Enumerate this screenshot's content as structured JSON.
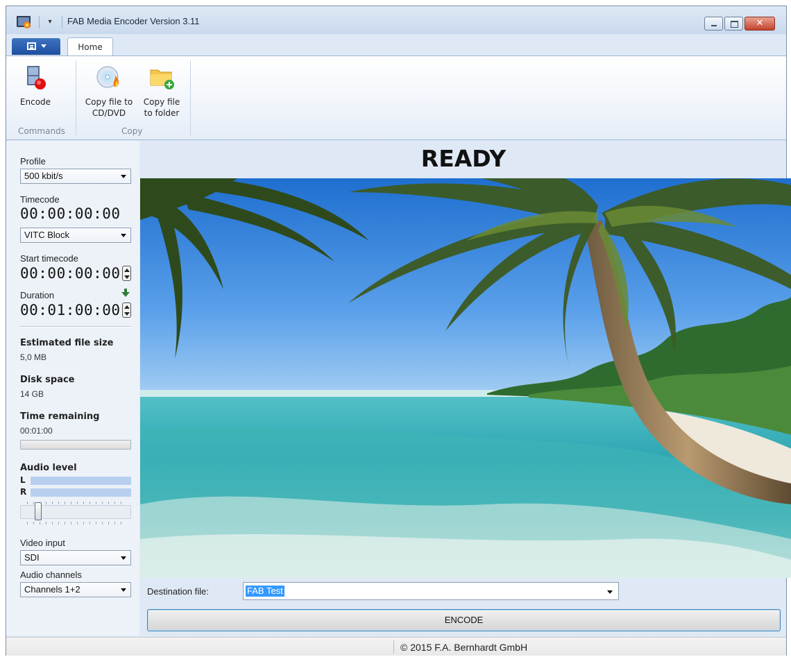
{
  "window": {
    "title": "FAB Media Encoder  Version 3.11",
    "icons": [
      "app-icon",
      "quick-access-dropdown-icon",
      "minimize-icon",
      "maximize-icon",
      "close-icon"
    ]
  },
  "ribbon": {
    "tabs": [
      {
        "label": "Home",
        "active": true
      }
    ],
    "buttons": {
      "encode": {
        "label": "Encode",
        "icon": "film-record-icon"
      },
      "copy_cd": {
        "label1": "Copy file to",
        "label2": "CD/DVD",
        "icon": "disc-burn-icon"
      },
      "copy_folder": {
        "label1": "Copy file",
        "label2": "to folder",
        "icon": "folder-add-icon"
      }
    },
    "groups": {
      "commands": "Commands",
      "copy": "Copy"
    }
  },
  "left": {
    "profile_label": "Profile",
    "profile_value": "500 kbit/s",
    "timecode_label": "Timecode",
    "timecode_value": "00:00:00:00",
    "timecode_source": "VITC Block",
    "start_timecode_label": "Start timecode",
    "start_timecode_value": "00:00:00:00",
    "duration_label": "Duration",
    "duration_value": "00:01:00:00",
    "est_size_label": "Estimated file size",
    "est_size_value": "5,0 MB",
    "disk_label": "Disk space",
    "disk_value": "14 GB",
    "time_remaining_label": "Time remaining",
    "time_remaining_value": "00:01:00",
    "time_remaining_progress": 0,
    "audio_label": "Audio level",
    "audio_l": "L",
    "audio_r": "R",
    "audio_slider_level": 0.1,
    "video_input_label": "Video input",
    "video_input_value": "SDI",
    "audio_channels_label": "Audio channels",
    "audio_channels_value": "Channels 1+2"
  },
  "main": {
    "status": "READY",
    "destination_label": "Destination file:",
    "destination_value": "FAB Test",
    "encode_button": "ENCODE"
  },
  "statusbar": {
    "copyright": "© 2015 F.A. Bernhardt GmbH"
  },
  "colors": {
    "accent": "#3c7fb1",
    "app_menu": "#1d4e9e",
    "selection": "#3399ff",
    "audio_meter": "#b8cff0"
  }
}
